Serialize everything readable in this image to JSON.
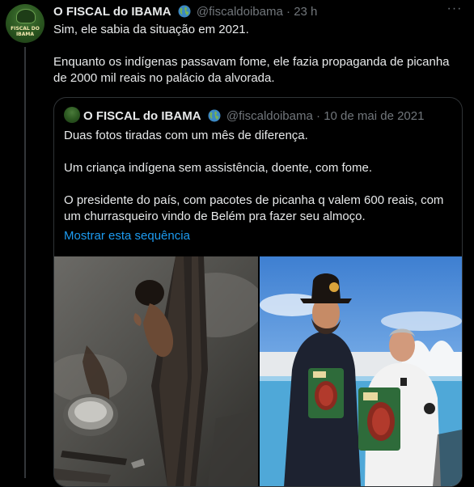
{
  "tweet": {
    "author_name": "O FISCAL do IBAMA",
    "author_handle": "@fiscaldoibama",
    "separator": "·",
    "time": "23 h",
    "avatar_text": "FISCAL DO IBAMA",
    "more_label": "···",
    "paragraphs": [
      "Sim, ele sabia da situação em 2021.",
      "Enquanto os indígenas passavam fome, ele fazia propaganda de picanha de 2000 mil reais no palácio da alvorada."
    ]
  },
  "quoted": {
    "author_name": "O FISCAL do IBAMA",
    "author_handle": "@fiscaldoibama",
    "separator": "·",
    "date": "10 de mai de 2021",
    "paragraphs": [
      "Duas fotos tiradas com um mês de diferença.",
      "Um criança indígena sem assistência, doente, com fome.",
      "O presidente do país, com pacotes de picanha q valem 600 reais, com um churrasqueiro vindo de Belém pra fazer seu almoço."
    ],
    "show_thread": "Mostrar esta sequência"
  },
  "icons": {
    "globe": "globe-emoji-icon",
    "more": "more-icon"
  },
  "colors": {
    "background": "#000000",
    "text": "#e7e9ea",
    "muted": "#71767b",
    "link": "#1d9bf0",
    "border": "#2f3336"
  }
}
